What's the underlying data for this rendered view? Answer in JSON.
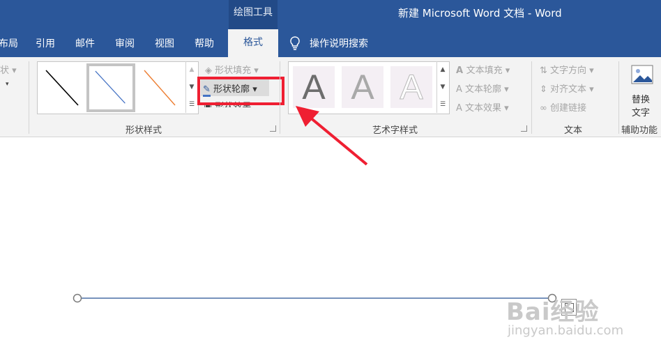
{
  "title_bar": {
    "context_tools": "绘图工具",
    "document_title": "新建 Microsoft Word 文档 - Word"
  },
  "tabs": [
    {
      "label": "布局"
    },
    {
      "label": "引用"
    },
    {
      "label": "邮件"
    },
    {
      "label": "审阅"
    },
    {
      "label": "视图"
    },
    {
      "label": "帮助"
    },
    {
      "label": "格式"
    }
  ],
  "tell_me": "操作说明搜索",
  "ribbon": {
    "partial_left": "状",
    "shape_styles": {
      "label": "形状样式",
      "fill": "形状填充",
      "outline": "形状轮廓",
      "effects": "形状效果",
      "swatch_colors": [
        "#000000",
        "#4472c4",
        "#ed7d31"
      ]
    },
    "wordart_styles": {
      "label": "艺术字样式",
      "letter": "A",
      "text_fill": "文本填充",
      "text_outline": "文本轮廓",
      "text_effects": "文本效果"
    },
    "text": {
      "label": "文本",
      "direction": "文字方向",
      "align": "对齐文本",
      "link": "创建链接"
    },
    "accessibility": {
      "label": "辅助功能",
      "alt_text_line1": "替换",
      "alt_text_line2": "文字"
    }
  },
  "watermark": {
    "brand": "Bai经验",
    "url": "jingyan.baidu.com"
  },
  "colors": {
    "accent": "#2b579a",
    "highlight": "#ef1f32",
    "line": "#4a6fa5"
  }
}
